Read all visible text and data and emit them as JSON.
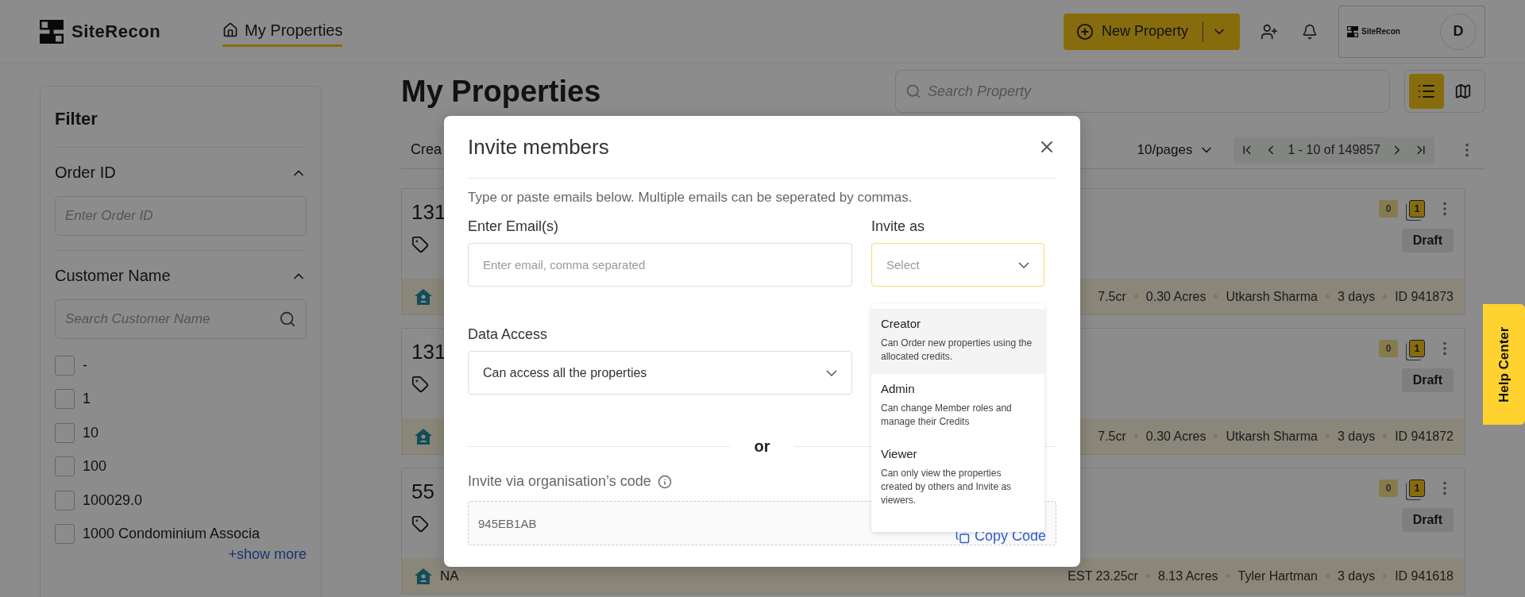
{
  "header": {
    "logo": "SiteRecon",
    "nav": [
      {
        "label": "My Properties",
        "selected": true
      }
    ],
    "new_property": "New Property",
    "account": {
      "logo": "SiteRecon",
      "avatar": "D"
    }
  },
  "filter": {
    "title": "Filter",
    "sections": [
      {
        "kind": "input",
        "title": "Order ID",
        "expanded": true,
        "placeholder": "Enter Order ID"
      },
      {
        "kind": "search",
        "title": "Customer Name",
        "expanded": true,
        "placeholder": "Search Customer Name",
        "options": [
          {
            "label": "-",
            "checked": false
          },
          {
            "label": "1",
            "checked": false
          },
          {
            "label": "10",
            "checked": false
          },
          {
            "label": "100",
            "checked": false
          },
          {
            "label": "100029.0",
            "checked": false
          },
          {
            "label": "1000 Condominium Associa",
            "checked": false
          }
        ],
        "show_more": "+show more"
      }
    ]
  },
  "main": {
    "title": "My Properties",
    "search_placeholder": "Search Property",
    "views": [
      {
        "kind": "list",
        "selected": true
      },
      {
        "kind": "map",
        "selected": false
      }
    ],
    "sort_label": "Crea",
    "page_size": "10/pages",
    "range": "1 - 10 of 149857",
    "properties": [
      {
        "title": "131",
        "comments": "0",
        "layers": "1",
        "status": "Draft",
        "stats": [
          "7.5cr",
          "0.30 Acres",
          "Utkarsh Sharma",
          "3 days",
          "ID 941873"
        ]
      },
      {
        "title": "131",
        "comments": "0",
        "layers": "1",
        "status": "Draft",
        "stats": [
          "7.5cr",
          "0.30 Acres",
          "Utkarsh Sharma",
          "3 days",
          "ID 941872"
        ]
      },
      {
        "title": "55",
        "comments": "0",
        "layers": "1",
        "status": "Draft",
        "address": "NA",
        "stats": [
          "EST 23.25cr",
          "8.13 Acres",
          "Tyler Hartman",
          "3 days",
          "ID 941618"
        ]
      }
    ]
  },
  "modal": {
    "title": "Invite members",
    "description": "Type or paste emails below. Multiple emails can be seperated by commas.",
    "email": {
      "label": "Enter Email(s)",
      "placeholder": "Enter email, comma separated"
    },
    "invite_as": {
      "label": "Invite as",
      "placeholder": "Select",
      "expanded": true,
      "options": [
        {
          "label": "Creator",
          "description": "Can Order new properties using the allocated credits.",
          "highlighted": true
        },
        {
          "label": "Admin",
          "description": "Can change Member roles and manage their Credits",
          "highlighted": false
        },
        {
          "label": "Viewer",
          "description": "Can only view the properties created by others and Invite as viewers.",
          "highlighted": false
        }
      ]
    },
    "data_access": {
      "label": "Data Access",
      "value": "Can access all the properties"
    },
    "divider": "or",
    "code": {
      "label": "Invite via organisation’s code",
      "value": "945EB1AB",
      "copy": "Copy Code"
    }
  },
  "help_center": "Help Center"
}
